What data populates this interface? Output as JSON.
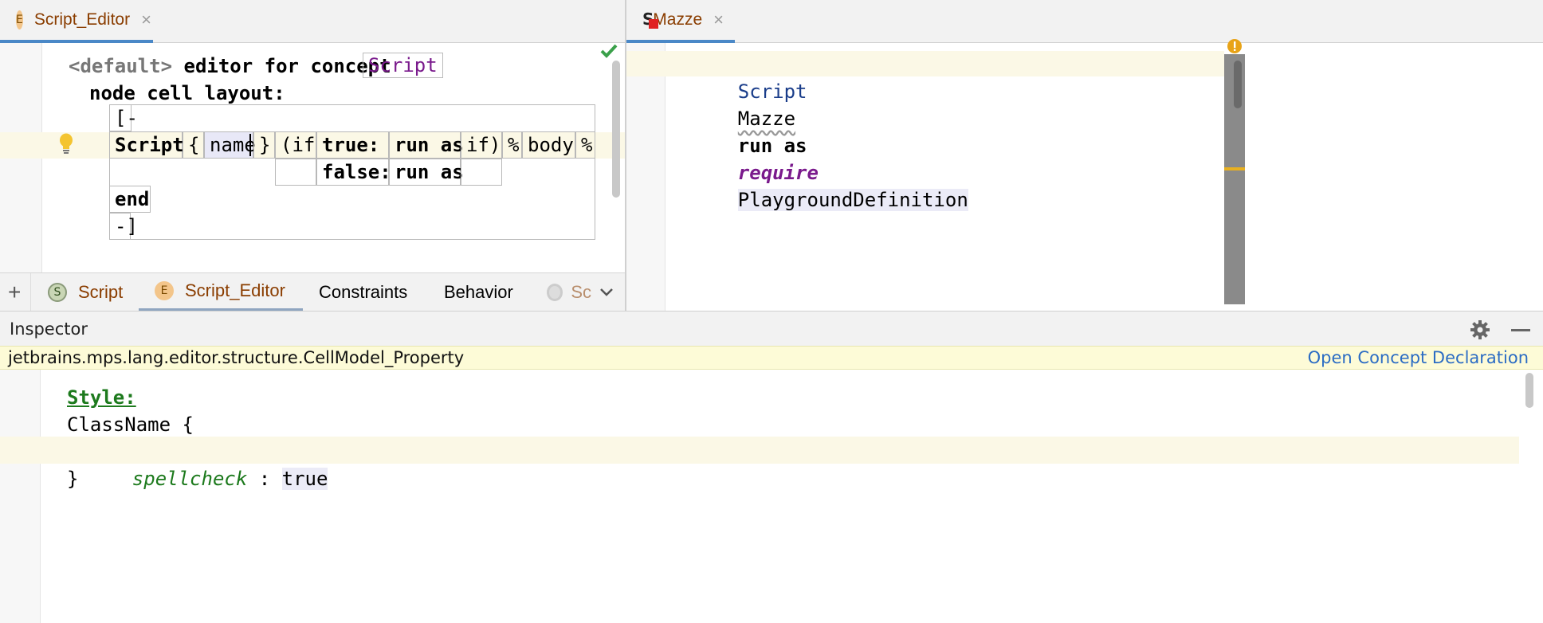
{
  "left_tab": {
    "badge": "E",
    "label": "Script_Editor",
    "close": "×"
  },
  "right_tab": {
    "label": "Mazze",
    "close": "×"
  },
  "editor": {
    "line1_prefix": "<default>",
    "line1_main": " editor for concept ",
    "concept_ref": "Script",
    "line2": "node cell layout:",
    "open_bracket": "[-",
    "row1": [
      "Script",
      "{",
      "name",
      "}",
      "(if",
      "true:",
      "run as",
      "if)",
      "%",
      "body",
      "%"
    ],
    "row2": [
      "false:",
      "run as"
    ],
    "end": "end",
    "close_bracket": "-]"
  },
  "bottom_tabs": {
    "add": "+",
    "items": [
      {
        "badge": "S",
        "label": "Script"
      },
      {
        "badge": "E",
        "label": "Script_Editor"
      },
      {
        "label": "Constraints"
      },
      {
        "label": "Behavior"
      },
      {
        "label": "Sc"
      }
    ],
    "more": "⌄"
  },
  "right_editor": {
    "kw_script": "Script",
    "name": "Mazze",
    "run_as": "run as",
    "require": "require",
    "definition": "PlaygroundDefinition"
  },
  "inspector": {
    "title": "Inspector",
    "concept": "jetbrains.mps.lang.editor.structure.CellModel_Property",
    "open_link": "Open Concept Declaration",
    "style_label": "Style:",
    "class_line": "ClassName {",
    "prop_name": "spellcheck",
    "prop_sep": " : ",
    "prop_value": "true",
    "close_brace": "}"
  },
  "colors": {
    "accent_blue": "#4a88c7",
    "tab_text": "#8a3d00",
    "concept_purple": "#7a1a8c",
    "style_green": "#1d7a1d",
    "highlight_yellow": "#fbf8e6",
    "banner_yellow": "#fdfbd7",
    "warning_orange": "#e8a317"
  }
}
